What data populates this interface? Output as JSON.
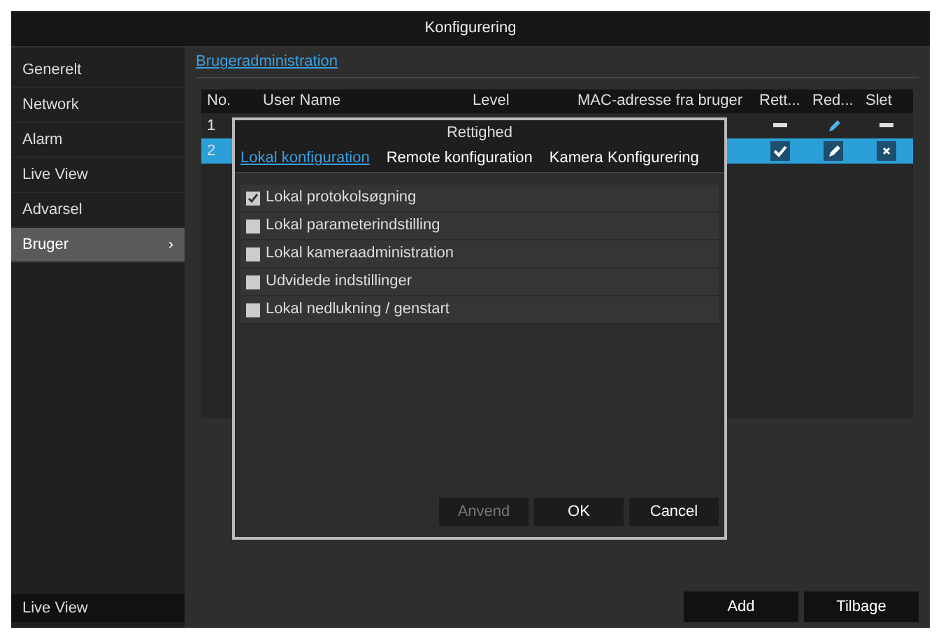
{
  "window": {
    "title": "Konfigurering"
  },
  "sidebar": {
    "items": [
      {
        "label": "Generelt",
        "selected": false
      },
      {
        "label": "Network",
        "selected": false
      },
      {
        "label": "Alarm",
        "selected": false
      },
      {
        "label": "Live View",
        "selected": false
      },
      {
        "label": "Advarsel",
        "selected": false
      },
      {
        "label": "Bruger",
        "selected": true,
        "arrow": "›"
      }
    ],
    "footer_button": "Live View"
  },
  "content": {
    "tab": "Brugeradministration",
    "table": {
      "columns": [
        "No.",
        "User Name",
        "Level",
        "MAC-adresse fra bruger",
        "Rett...",
        "Red...",
        "Slet"
      ],
      "rows": [
        {
          "no": "1",
          "selected": false,
          "icons": [
            {
              "kind": "dash"
            },
            {
              "kind": "edit"
            },
            {
              "kind": "dash"
            }
          ]
        },
        {
          "no": "2",
          "selected": true,
          "icons": [
            {
              "kind": "check"
            },
            {
              "kind": "edit"
            },
            {
              "kind": "delete"
            }
          ]
        }
      ]
    },
    "buttons": [
      "Add",
      "Tilbage"
    ]
  },
  "dialog": {
    "title": "Rettighed",
    "tabs": [
      {
        "label": "Lokal konfiguration",
        "selected": true
      },
      {
        "label": "Remote konfiguration",
        "selected": false
      },
      {
        "label": "Kamera Konfigurering",
        "selected": false
      }
    ],
    "options": [
      {
        "label": "Lokal protokolsøgning",
        "checked": true
      },
      {
        "label": "Lokal parameterindstilling",
        "checked": false
      },
      {
        "label": "Lokal kameraadministration",
        "checked": false
      },
      {
        "label": "Udvidede indstillinger",
        "checked": false
      },
      {
        "label": "Lokal nedlukning / genstart",
        "checked": false
      }
    ],
    "buttons": [
      {
        "label": "Anvend",
        "disabled": true
      },
      {
        "label": "OK",
        "disabled": false
      },
      {
        "label": "Cancel",
        "disabled": false
      }
    ]
  }
}
